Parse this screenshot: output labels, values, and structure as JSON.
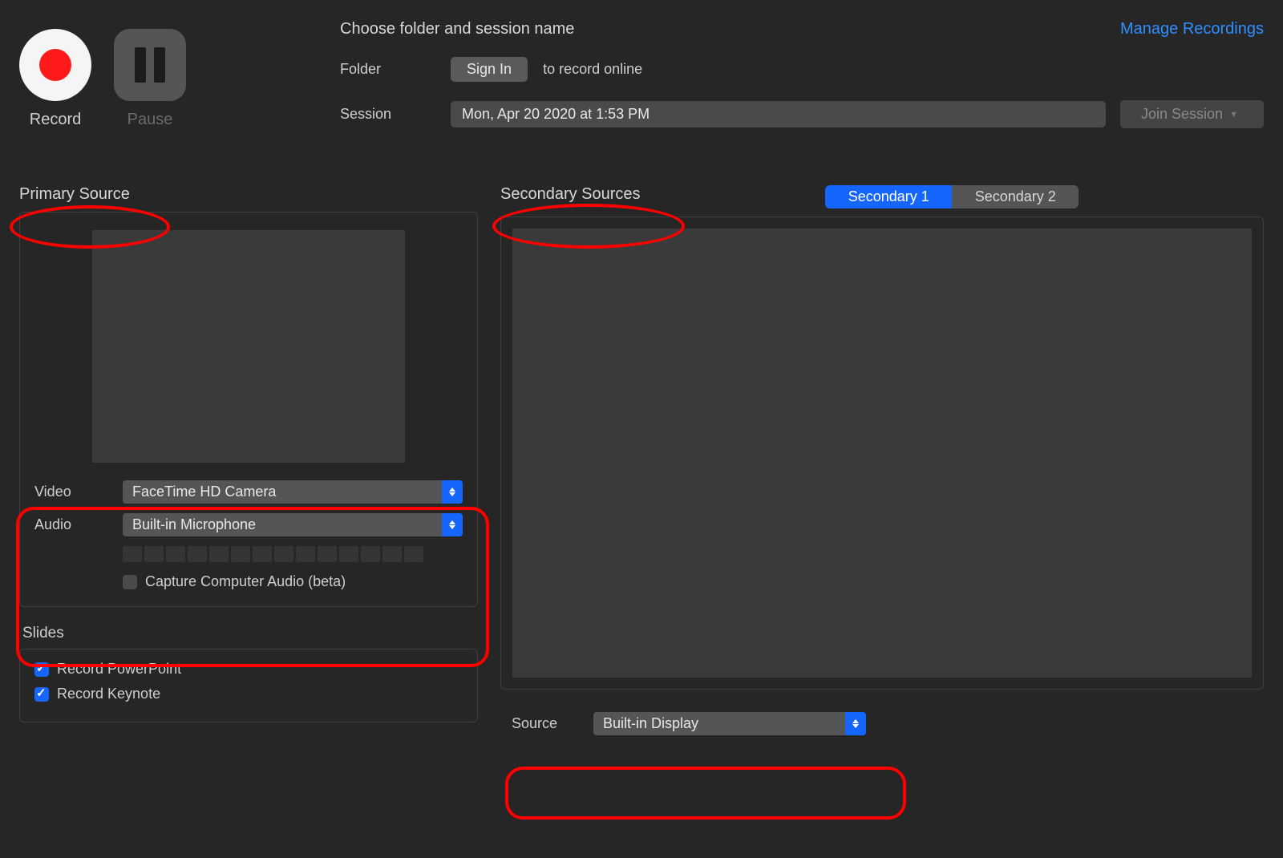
{
  "header": {
    "title": "Choose folder and session name",
    "manage_link": "Manage Recordings",
    "folder_label": "Folder",
    "signin_label": "Sign In",
    "folder_note": "to record online",
    "session_label": "Session",
    "session_value": "Mon, Apr 20 2020 at 1:53 PM",
    "join_label": "Join Session"
  },
  "controls": {
    "record_label": "Record",
    "pause_label": "Pause"
  },
  "primary": {
    "title": "Primary Source",
    "video_label": "Video",
    "video_value": "FaceTime HD Camera",
    "audio_label": "Audio",
    "audio_value": "Built-in Microphone",
    "capture_audio_label": "Capture Computer Audio (beta)"
  },
  "slides": {
    "title": "Slides",
    "powerpoint_label": "Record PowerPoint",
    "keynote_label": "Record Keynote"
  },
  "secondary": {
    "title": "Secondary Sources",
    "tab1": "Secondary 1",
    "tab2": "Secondary 2",
    "source_label": "Source",
    "source_value": "Built-in Display"
  }
}
